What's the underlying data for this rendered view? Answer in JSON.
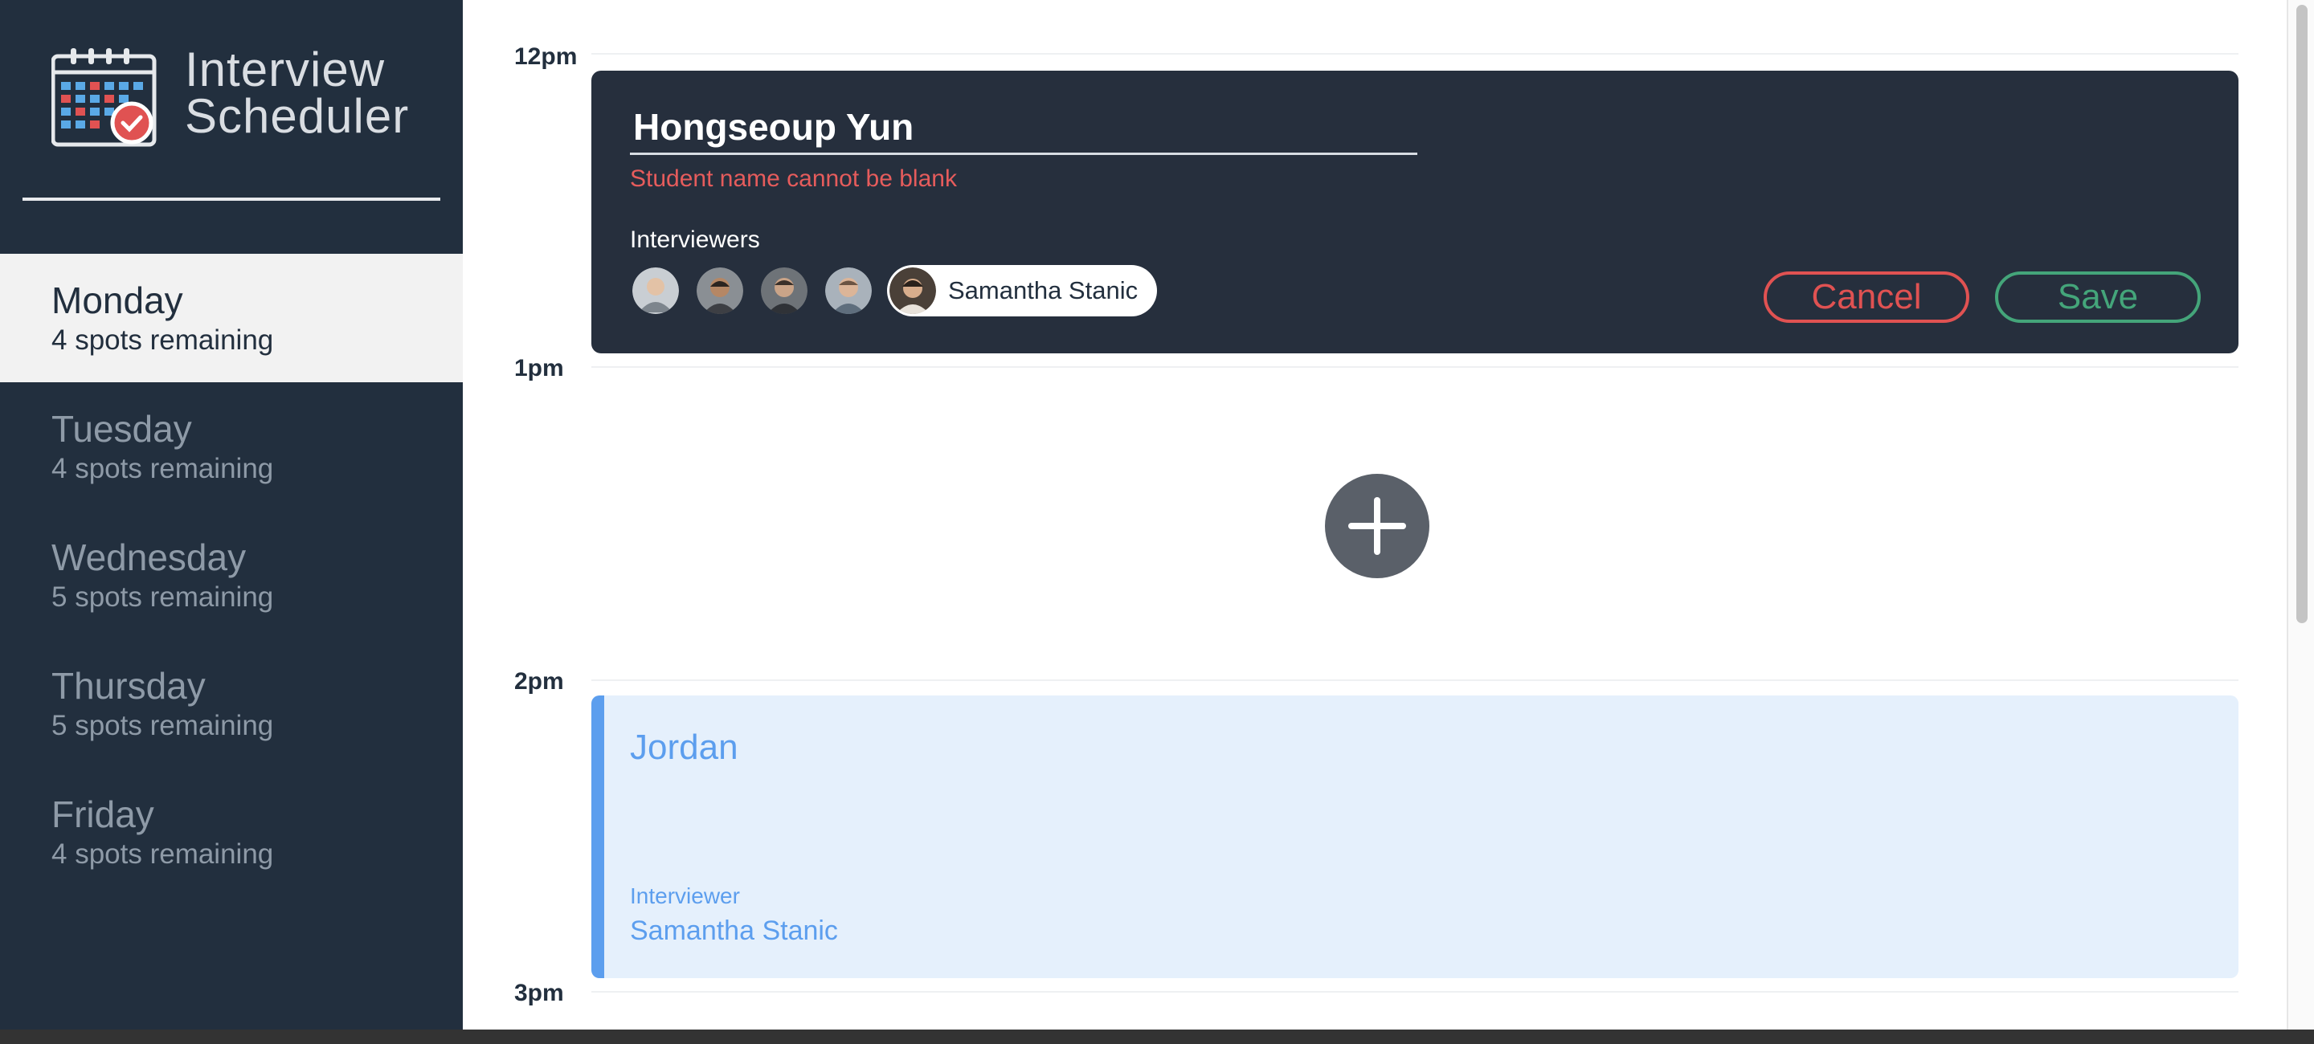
{
  "app": {
    "title_line1": "Interview",
    "title_line2": "Scheduler",
    "logo_icon": "calendar-check-icon"
  },
  "sidebar": {
    "days": [
      {
        "name": "Monday",
        "spots": "4 spots remaining",
        "selected": true
      },
      {
        "name": "Tuesday",
        "spots": "4 spots remaining",
        "selected": false
      },
      {
        "name": "Wednesday",
        "spots": "5 spots remaining",
        "selected": false
      },
      {
        "name": "Thursday",
        "spots": "5 spots remaining",
        "selected": false
      },
      {
        "name": "Friday",
        "spots": "4 spots remaining",
        "selected": false
      }
    ]
  },
  "schedule": {
    "times": [
      "12pm",
      "1pm",
      "2pm",
      "3pm"
    ],
    "form": {
      "student_name_value": "Hongseoup Yun",
      "validation_error": "Student name cannot be blank",
      "interviewers_label": "Interviewers",
      "interviewers": [
        {
          "selected": false
        },
        {
          "selected": false
        },
        {
          "selected": false
        },
        {
          "selected": false
        },
        {
          "name": "Samantha Stanic",
          "selected": true
        }
      ],
      "cancel_label": "Cancel",
      "save_label": "Save"
    },
    "add_button_icon": "plus-icon",
    "appointment": {
      "student": "Jordan",
      "interviewer_label": "Interviewer",
      "interviewer_name": "Samantha Stanic"
    }
  },
  "colors": {
    "sidebar_bg": "#222f3e",
    "error": "#e05252",
    "save": "#44a57a",
    "appointment_accent": "#5c9eee"
  }
}
